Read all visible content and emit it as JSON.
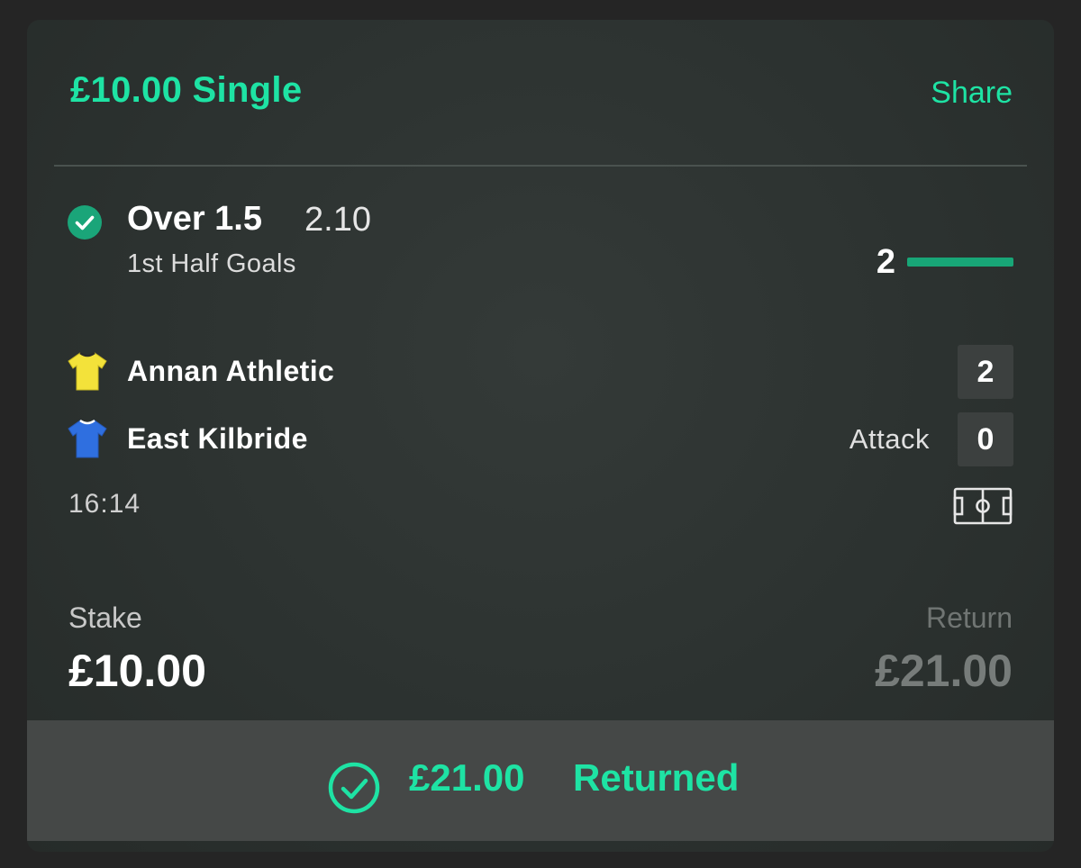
{
  "bet": {
    "title": "£10.00 Single",
    "share_label": "Share"
  },
  "selection": {
    "name": "Over 1.5",
    "odds": "2.10",
    "market": "1st Half Goals",
    "status_icon": "check-circle-icon",
    "progress_value": "2",
    "progress_fraction": 1.0
  },
  "match": {
    "home_team": {
      "name": "Annan Athletic",
      "score": "2",
      "shirt_color": "#f3e23a",
      "icon": "shirt-icon"
    },
    "away_team": {
      "name": "East Kilbride",
      "score": "0",
      "shirt_color": "#2f6fe0",
      "icon": "shirt-icon",
      "state": "Attack"
    },
    "time": "16:14",
    "pitch_icon": "pitch-icon"
  },
  "stake": {
    "label": "Stake",
    "value": "£10.00"
  },
  "return": {
    "label": "Return",
    "value": "£21.00"
  },
  "result": {
    "amount": "£21.00",
    "label": "Returned",
    "icon": "check-circle-outline-icon"
  },
  "colors": {
    "accent": "#1ee3a4",
    "progress": "#18a677",
    "background": "#2c3230"
  }
}
